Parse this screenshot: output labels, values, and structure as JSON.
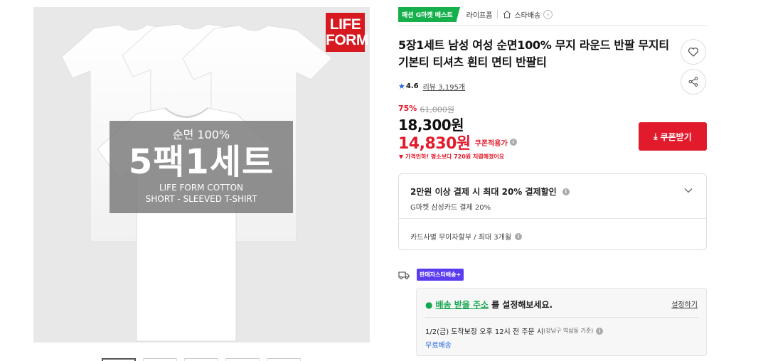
{
  "product_image": {
    "brand_logo_line1": "LIFE",
    "brand_logo_line2": "FORM",
    "promo_sub": "순면 100%",
    "promo_main": "5팩1세트",
    "promo_eng1": "LIFE FORM COTTON",
    "promo_eng2": "SHORT - SLEEVED T-SHIRT"
  },
  "tags": {
    "best": "패션 G마켓 베스트",
    "shop": "라이프폼",
    "star_delivery": "스타배송"
  },
  "title": "5장1세트 남성 여성 순면100% 무지 라운드 반팔 무지티 기본티 티셔츠 흰티 면티 반팔티",
  "rating": {
    "score": "4.6",
    "review": "리뷰 3,195개"
  },
  "price": {
    "discount_rate": "75%",
    "original": "61,000원",
    "sale": "18,300원",
    "coupon_price": "14,830원",
    "coupon_label": "쿠폰적용가",
    "lowest_note": "가격인하! 평소보다 720원 저렴해졌어요"
  },
  "coupon_button": "쿠폰받기",
  "card_benefit": {
    "title": "2만원 이상 결제 시 최대 20% 결제할인",
    "subtitle": "G마켓 삼성카드 결제 20%",
    "installment": "카드사별 무이자할부 / 최대 3개월"
  },
  "shipping": {
    "badge": "판매자스타배송+",
    "addr_link": "배송 받을 주소",
    "addr_rest": "를 설정해보세요.",
    "addr_set": "설정하기",
    "delivery_main": "1/2(금) 도착보장  오후 12시 전 주문 시",
    "delivery_note": "(강남구 역삼동 기준)",
    "free": "무료배송"
  },
  "colors": {
    "accent_red": "#e21b2c",
    "badge_green": "#15b04b",
    "star_blue": "#1d63e8",
    "badge_purple": "#5b3cf0"
  },
  "icons": [
    "heart-icon",
    "share-icon",
    "home-icon",
    "star-icon",
    "download-icon",
    "info-icon",
    "chevron-down-icon",
    "truck-icon",
    "location-pin-icon",
    "arrow-down-icon"
  ]
}
